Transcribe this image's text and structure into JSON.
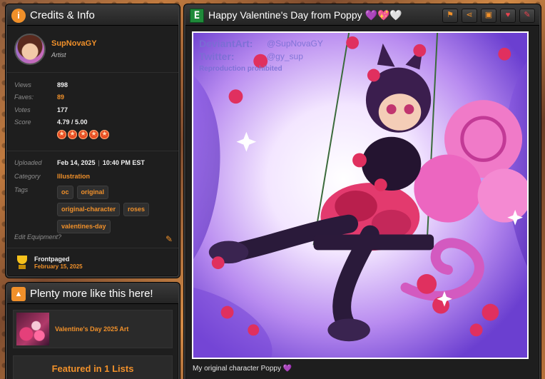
{
  "credits": {
    "header_title": "Credits & Info",
    "artist": {
      "name": "SupNovaGY",
      "role": "Artist"
    },
    "stats": [
      {
        "label": "Views",
        "value": "898"
      },
      {
        "label": "Faves:",
        "value": "89"
      },
      {
        "label": "Votes",
        "value": "177"
      },
      {
        "label": "Score",
        "value": "4.79 / 5.00"
      }
    ],
    "rating_stars": 5,
    "uploaded": {
      "label": "Uploaded",
      "date": "Feb 14, 2025",
      "time": "10:40 PM EST"
    },
    "category": {
      "label": "Category",
      "value": "Illustration"
    },
    "tags_label": "Tags",
    "tags": [
      "oc",
      "original",
      "original-character",
      "roses",
      "valentines-day"
    ],
    "edit_label": "Edit Equipment?",
    "frontpaged": {
      "title": "Frontpaged",
      "date": "February 15, 2025"
    }
  },
  "more": {
    "header_title": "Plenty more like this here!",
    "item_title": "Valentine's Day 2025 Art",
    "featured_label": "Featured in 1 Lists"
  },
  "art": {
    "title": "Happy Valentine's Day from Poppy 💜💖🤍",
    "caption": "My original character Poppy 💜",
    "watermark": {
      "line1": "DeviantArt:",
      "handle1": "@SupNovaGY",
      "line2": "Twitter:",
      "handle2": "@gy_sup",
      "line3": "Reproduction prohibited"
    },
    "signature": "SupNovaGY",
    "actions": [
      {
        "icon": "flag-icon",
        "glyph": "⚑"
      },
      {
        "icon": "share-icon",
        "glyph": "⋖"
      },
      {
        "icon": "collection-icon",
        "glyph": "▣"
      },
      {
        "icon": "favorite-heart-icon",
        "glyph": "♥"
      },
      {
        "icon": "review-pencil-icon",
        "glyph": "✎"
      }
    ]
  }
}
